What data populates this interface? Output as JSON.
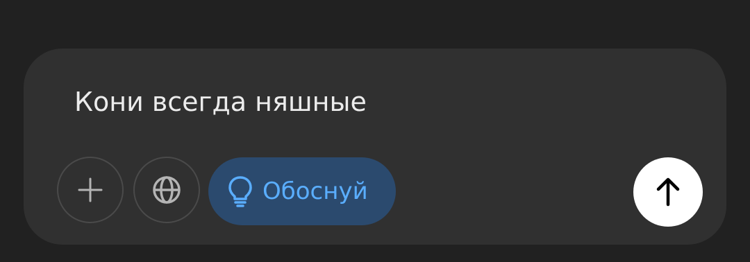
{
  "composer": {
    "message": "Кони всегда няшные"
  },
  "toolbar": {
    "add_icon": "plus-icon",
    "web_search_icon": "globe-icon",
    "reason_chip_icon": "lightbulb-icon",
    "reason_chip_label": "Обоснуй",
    "send_icon": "arrow-up-icon"
  },
  "colors": {
    "background": "#212121",
    "composer_background": "#303030",
    "chip_background": "#2b4a6e",
    "chip_accent": "#5aaeff",
    "send_button": "#ffffff"
  }
}
